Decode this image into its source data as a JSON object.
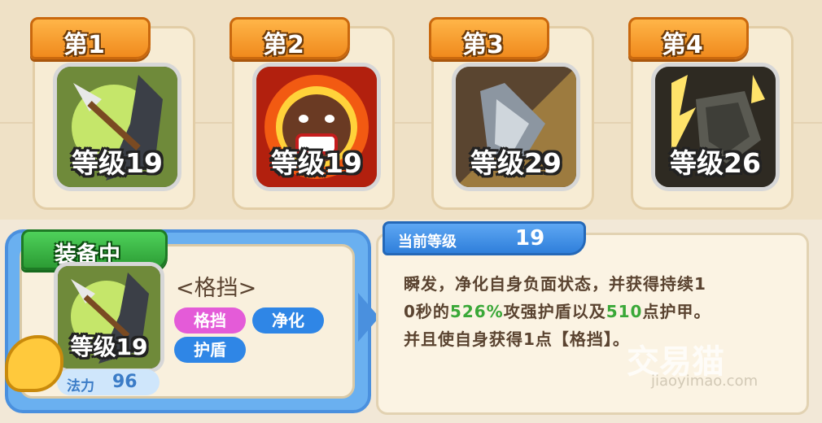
{
  "skills": [
    {
      "rank": "第1",
      "level": "等级19",
      "icon": "arrow-blade-icon"
    },
    {
      "rank": "第2",
      "level": "等级19",
      "icon": "angry-face-icon"
    },
    {
      "rank": "第3",
      "level": "等级29",
      "icon": "shield-icon"
    },
    {
      "rank": "第4",
      "level": "等级26",
      "icon": "rock-lightning-icon"
    }
  ],
  "equipped": {
    "ribbon": "装备中",
    "level": "等级19",
    "mana_label": "法力",
    "mana_value": "96",
    "name": "<格挡>",
    "tags": [
      "格挡",
      "净化",
      "护盾"
    ]
  },
  "detail": {
    "current_level_label": "当前等级",
    "current_level_value": "19",
    "line1": "瞬发，净化自身负面状态，并获得持续1",
    "line2_a": "0秒的",
    "line2_b": "526%",
    "line2_c": "攻强护盾以及",
    "line2_d": "510",
    "line2_e": "点护甲。",
    "line3": "并且使自身获得1点【格挡】。"
  },
  "watermark": {
    "main": "交易猫",
    "sub": "jiaoyimao.com"
  },
  "colors": {
    "rank_ribbon": "#f08a1d",
    "equip_ribbon": "#2c9c34",
    "highlight": "#3aa838",
    "tag_pink": "#e45bd8",
    "tag_blue": "#2f86e6"
  }
}
